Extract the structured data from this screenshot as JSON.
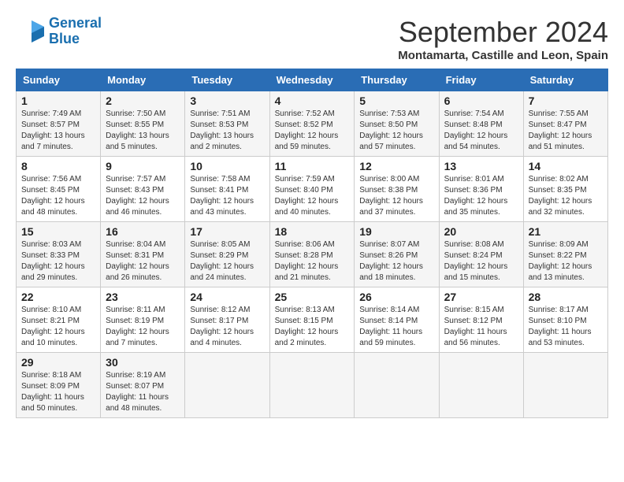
{
  "logo": {
    "line1": "General",
    "line2": "Blue"
  },
  "title": "September 2024",
  "subtitle": "Montamarta, Castille and Leon, Spain",
  "days_of_week": [
    "Sunday",
    "Monday",
    "Tuesday",
    "Wednesday",
    "Thursday",
    "Friday",
    "Saturday"
  ],
  "weeks": [
    [
      {
        "day": 1,
        "sunrise": "7:49 AM",
        "sunset": "8:57 PM",
        "daylight": "13 hours and 7 minutes"
      },
      {
        "day": 2,
        "sunrise": "7:50 AM",
        "sunset": "8:55 PM",
        "daylight": "13 hours and 5 minutes"
      },
      {
        "day": 3,
        "sunrise": "7:51 AM",
        "sunset": "8:53 PM",
        "daylight": "13 hours and 2 minutes"
      },
      {
        "day": 4,
        "sunrise": "7:52 AM",
        "sunset": "8:52 PM",
        "daylight": "12 hours and 59 minutes"
      },
      {
        "day": 5,
        "sunrise": "7:53 AM",
        "sunset": "8:50 PM",
        "daylight": "12 hours and 57 minutes"
      },
      {
        "day": 6,
        "sunrise": "7:54 AM",
        "sunset": "8:48 PM",
        "daylight": "12 hours and 54 minutes"
      },
      {
        "day": 7,
        "sunrise": "7:55 AM",
        "sunset": "8:47 PM",
        "daylight": "12 hours and 51 minutes"
      }
    ],
    [
      {
        "day": 8,
        "sunrise": "7:56 AM",
        "sunset": "8:45 PM",
        "daylight": "12 hours and 48 minutes"
      },
      {
        "day": 9,
        "sunrise": "7:57 AM",
        "sunset": "8:43 PM",
        "daylight": "12 hours and 46 minutes"
      },
      {
        "day": 10,
        "sunrise": "7:58 AM",
        "sunset": "8:41 PM",
        "daylight": "12 hours and 43 minutes"
      },
      {
        "day": 11,
        "sunrise": "7:59 AM",
        "sunset": "8:40 PM",
        "daylight": "12 hours and 40 minutes"
      },
      {
        "day": 12,
        "sunrise": "8:00 AM",
        "sunset": "8:38 PM",
        "daylight": "12 hours and 37 minutes"
      },
      {
        "day": 13,
        "sunrise": "8:01 AM",
        "sunset": "8:36 PM",
        "daylight": "12 hours and 35 minutes"
      },
      {
        "day": 14,
        "sunrise": "8:02 AM",
        "sunset": "8:35 PM",
        "daylight": "12 hours and 32 minutes"
      }
    ],
    [
      {
        "day": 15,
        "sunrise": "8:03 AM",
        "sunset": "8:33 PM",
        "daylight": "12 hours and 29 minutes"
      },
      {
        "day": 16,
        "sunrise": "8:04 AM",
        "sunset": "8:31 PM",
        "daylight": "12 hours and 26 minutes"
      },
      {
        "day": 17,
        "sunrise": "8:05 AM",
        "sunset": "8:29 PM",
        "daylight": "12 hours and 24 minutes"
      },
      {
        "day": 18,
        "sunrise": "8:06 AM",
        "sunset": "8:28 PM",
        "daylight": "12 hours and 21 minutes"
      },
      {
        "day": 19,
        "sunrise": "8:07 AM",
        "sunset": "8:26 PM",
        "daylight": "12 hours and 18 minutes"
      },
      {
        "day": 20,
        "sunrise": "8:08 AM",
        "sunset": "8:24 PM",
        "daylight": "12 hours and 15 minutes"
      },
      {
        "day": 21,
        "sunrise": "8:09 AM",
        "sunset": "8:22 PM",
        "daylight": "12 hours and 13 minutes"
      }
    ],
    [
      {
        "day": 22,
        "sunrise": "8:10 AM",
        "sunset": "8:21 PM",
        "daylight": "12 hours and 10 minutes"
      },
      {
        "day": 23,
        "sunrise": "8:11 AM",
        "sunset": "8:19 PM",
        "daylight": "12 hours and 7 minutes"
      },
      {
        "day": 24,
        "sunrise": "8:12 AM",
        "sunset": "8:17 PM",
        "daylight": "12 hours and 4 minutes"
      },
      {
        "day": 25,
        "sunrise": "8:13 AM",
        "sunset": "8:15 PM",
        "daylight": "12 hours and 2 minutes"
      },
      {
        "day": 26,
        "sunrise": "8:14 AM",
        "sunset": "8:14 PM",
        "daylight": "11 hours and 59 minutes"
      },
      {
        "day": 27,
        "sunrise": "8:15 AM",
        "sunset": "8:12 PM",
        "daylight": "11 hours and 56 minutes"
      },
      {
        "day": 28,
        "sunrise": "8:17 AM",
        "sunset": "8:10 PM",
        "daylight": "11 hours and 53 minutes"
      }
    ],
    [
      {
        "day": 29,
        "sunrise": "8:18 AM",
        "sunset": "8:09 PM",
        "daylight": "11 hours and 50 minutes"
      },
      {
        "day": 30,
        "sunrise": "8:19 AM",
        "sunset": "8:07 PM",
        "daylight": "11 hours and 48 minutes"
      },
      null,
      null,
      null,
      null,
      null
    ]
  ]
}
